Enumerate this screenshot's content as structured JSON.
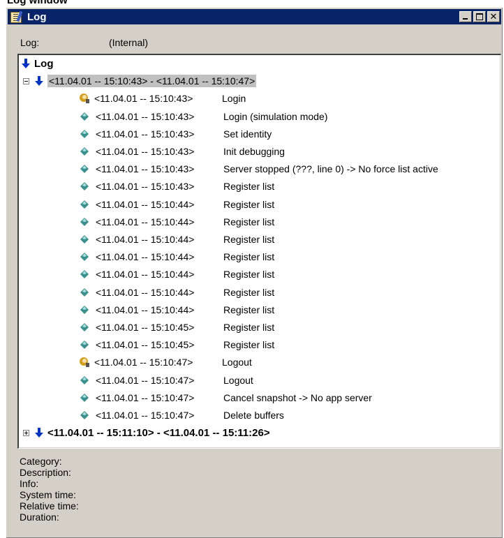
{
  "caption": "Log window",
  "window": {
    "title": "Log",
    "controls": {
      "minimize": "",
      "maximize": "",
      "close": "✕"
    }
  },
  "log_field": {
    "label": "Log:",
    "value": "(Internal)"
  },
  "tree": {
    "root_label": "Log",
    "group1_label": "<11.04.01 -- 15:10:43> - <11.04.01 -- 15:10:47>",
    "entries": [
      {
        "icon": "user-icon",
        "time": "<11.04.01 -- 15:10:43>",
        "text": "Login"
      },
      {
        "icon": "gem-icon",
        "time": "<11.04.01 -- 15:10:43>",
        "text": "Login (simulation mode)"
      },
      {
        "icon": "gem-icon",
        "time": "<11.04.01 -- 15:10:43>",
        "text": "Set identity"
      },
      {
        "icon": "gem-icon",
        "time": "<11.04.01 -- 15:10:43>",
        "text": "Init debugging"
      },
      {
        "icon": "gem-icon",
        "time": "<11.04.01 -- 15:10:43>",
        "text": "Server stopped (???, line 0) -> No force list active"
      },
      {
        "icon": "gem-icon",
        "time": "<11.04.01 -- 15:10:43>",
        "text": "Register list"
      },
      {
        "icon": "gem-icon",
        "time": "<11.04.01 -- 15:10:44>",
        "text": "Register list"
      },
      {
        "icon": "gem-icon",
        "time": "<11.04.01 -- 15:10:44>",
        "text": "Register list"
      },
      {
        "icon": "gem-icon",
        "time": "<11.04.01 -- 15:10:44>",
        "text": "Register list"
      },
      {
        "icon": "gem-icon",
        "time": "<11.04.01 -- 15:10:44>",
        "text": "Register list"
      },
      {
        "icon": "gem-icon",
        "time": "<11.04.01 -- 15:10:44>",
        "text": "Register list"
      },
      {
        "icon": "gem-icon",
        "time": "<11.04.01 -- 15:10:44>",
        "text": "Register list"
      },
      {
        "icon": "gem-icon",
        "time": "<11.04.01 -- 15:10:44>",
        "text": "Register list"
      },
      {
        "icon": "gem-icon",
        "time": "<11.04.01 -- 15:10:45>",
        "text": "Register list"
      },
      {
        "icon": "gem-icon",
        "time": "<11.04.01 -- 15:10:45>",
        "text": "Register list"
      },
      {
        "icon": "user-icon",
        "time": "<11.04.01 -- 15:10:47>",
        "text": "Logout"
      },
      {
        "icon": "gem-icon",
        "time": "<11.04.01 -- 15:10:47>",
        "text": "Logout"
      },
      {
        "icon": "gem-icon",
        "time": "<11.04.01 -- 15:10:47>",
        "text": "Cancel snapshot -> No app server"
      },
      {
        "icon": "gem-icon",
        "time": "<11.04.01 -- 15:10:47>",
        "text": "Delete buffers"
      }
    ],
    "group2_label": "<11.04.01 -- 15:11:10> - <11.04.01 -- 15:11:26>"
  },
  "details": {
    "category": "Category:",
    "description": "Description:",
    "info": "Info:",
    "system_time": "System time:",
    "relative_time": "Relative time:",
    "duration": "Duration:"
  },
  "colors": {
    "titlebar": "#0a246a",
    "face": "#d4d0c8",
    "arrow": "#0033cc",
    "gem": "#3a8f8f",
    "selection": "#c0c0c0"
  }
}
